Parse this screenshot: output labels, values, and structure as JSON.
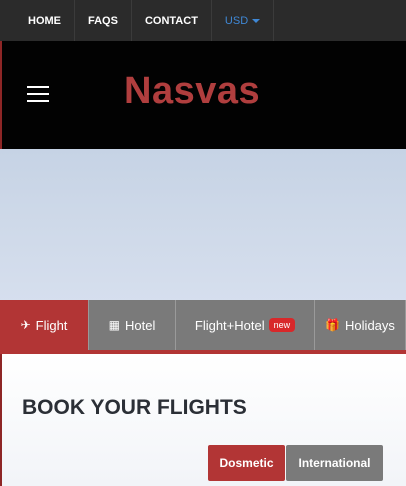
{
  "topbar": {
    "items": [
      {
        "label": "HOME"
      },
      {
        "label": "FAQS"
      },
      {
        "label": "CONTACT"
      }
    ],
    "currency": "USD"
  },
  "header": {
    "logo": "Nasvas",
    "menu_icon": "hamburger-menu-icon"
  },
  "tabs": [
    {
      "label": "Flight",
      "icon": "airplane-icon",
      "active": true
    },
    {
      "label": "Hotel",
      "icon": "building-icon",
      "active": false
    },
    {
      "label": "Flight+Hotel",
      "badge": "new",
      "active": false
    },
    {
      "label": "Holidays",
      "icon": "gift-icon",
      "active": false
    }
  ],
  "panel": {
    "title": "BOOK YOUR FLIGHTS",
    "trip_types": [
      {
        "label": "Dosmetic",
        "active": true
      },
      {
        "label": "International",
        "active": false
      }
    ]
  },
  "colors": {
    "brand": "#b03e3e",
    "accent_active": "#b23535",
    "tab_inactive": "#7a7a7a",
    "currency_link": "#3f88d6"
  }
}
